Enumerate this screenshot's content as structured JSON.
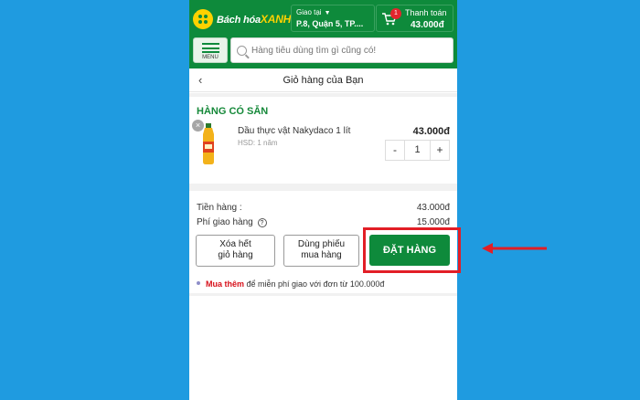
{
  "header": {
    "logo_text": "Bách hóa",
    "logo_brand": "XANH",
    "deliver_label": "Giao tại",
    "deliver_address": "P.8, Quận 5, TP....",
    "cart_label": "Thanh toán",
    "cart_badge": "1",
    "cart_total": "43.000đ",
    "menu_label": "MENU",
    "search_placeholder": "Hàng tiêu dùng tìm gì cũng có!"
  },
  "page": {
    "back": "‹",
    "title": "Giỏ hàng của Bạn",
    "section_title": "HÀNG CÓ SẴN"
  },
  "cart": {
    "items": [
      {
        "name": "Dầu thực vật Nakydaco 1 lít",
        "expiry": "HSD: 1 năm",
        "price": "43.000đ",
        "quantity": "1",
        "minus": "-",
        "plus": "+",
        "remove": "×"
      }
    ]
  },
  "summary": {
    "goods_label": "Tiền hàng :",
    "goods_value": "43.000đ",
    "ship_label": "Phí giao hàng",
    "ship_help": "?",
    "ship_value": "15.000đ"
  },
  "actions": {
    "clear_line1": "Xóa hết",
    "clear_line2": "giỏ hàng",
    "voucher_line1": "Dùng phiếu",
    "voucher_line2": "mua hàng",
    "order": "ĐẶT HÀNG"
  },
  "promo": {
    "strong": "Mua thêm",
    "text": " để miễn phí giao với đơn từ 100.000đ"
  },
  "colors": {
    "background": "#1f9be0",
    "brand_green": "#0e8a3b",
    "annotation_red": "#e21e26"
  }
}
